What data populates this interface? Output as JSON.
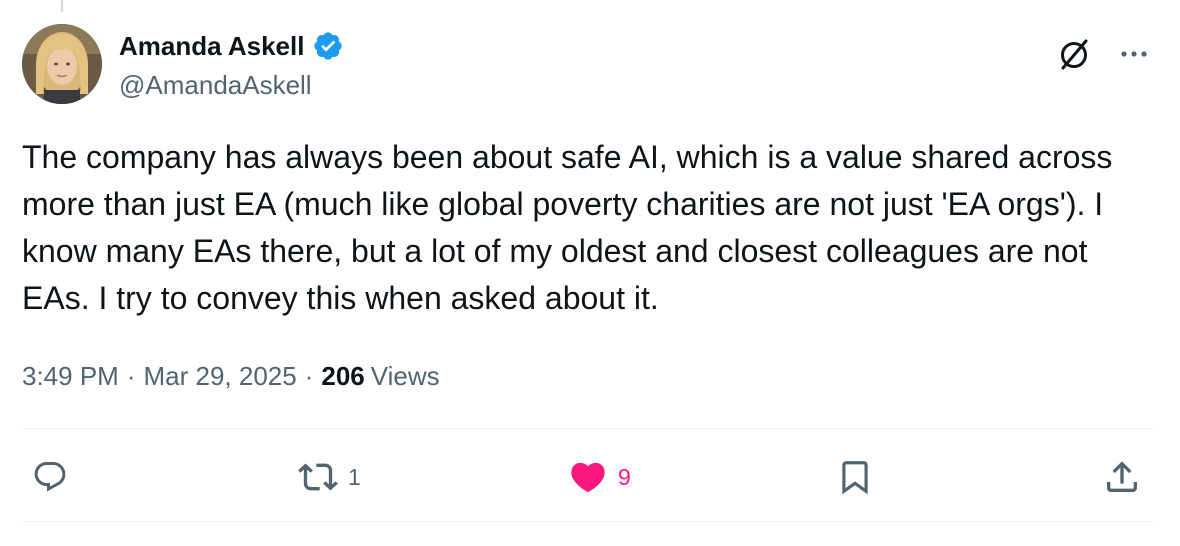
{
  "author": {
    "display_name": "Amanda Askell",
    "handle": "@AmandaAskell",
    "verified": true,
    "avatar_icon": "profile-photo"
  },
  "header_icons": {
    "grok": "grok-icon",
    "more": "more-icon"
  },
  "tweet": {
    "text": "The company has always been about safe AI, which is a value shared across more than just EA (much like global poverty charities are not just 'EA orgs'). I know many EAs there, but a lot of my oldest and closest colleagues are not EAs. I try to convey this when asked about it."
  },
  "meta": {
    "time": "3:49 PM",
    "separator": "·",
    "date": "Mar 29, 2025",
    "views_count": "206",
    "views_label": "Views"
  },
  "actions": {
    "reply": {
      "icon": "reply-icon",
      "count": ""
    },
    "retweet": {
      "icon": "retweet-icon",
      "count": "1"
    },
    "like": {
      "icon": "heart-icon",
      "count": "9",
      "liked": true
    },
    "bookmark": {
      "icon": "bookmark-icon",
      "count": ""
    },
    "share": {
      "icon": "share-icon",
      "count": ""
    }
  },
  "colors": {
    "text_primary": "#0f1419",
    "text_secondary": "#536471",
    "verified_blue": "#1d9bf0",
    "like_pink": "#f91880",
    "divider": "#eff3f4"
  }
}
